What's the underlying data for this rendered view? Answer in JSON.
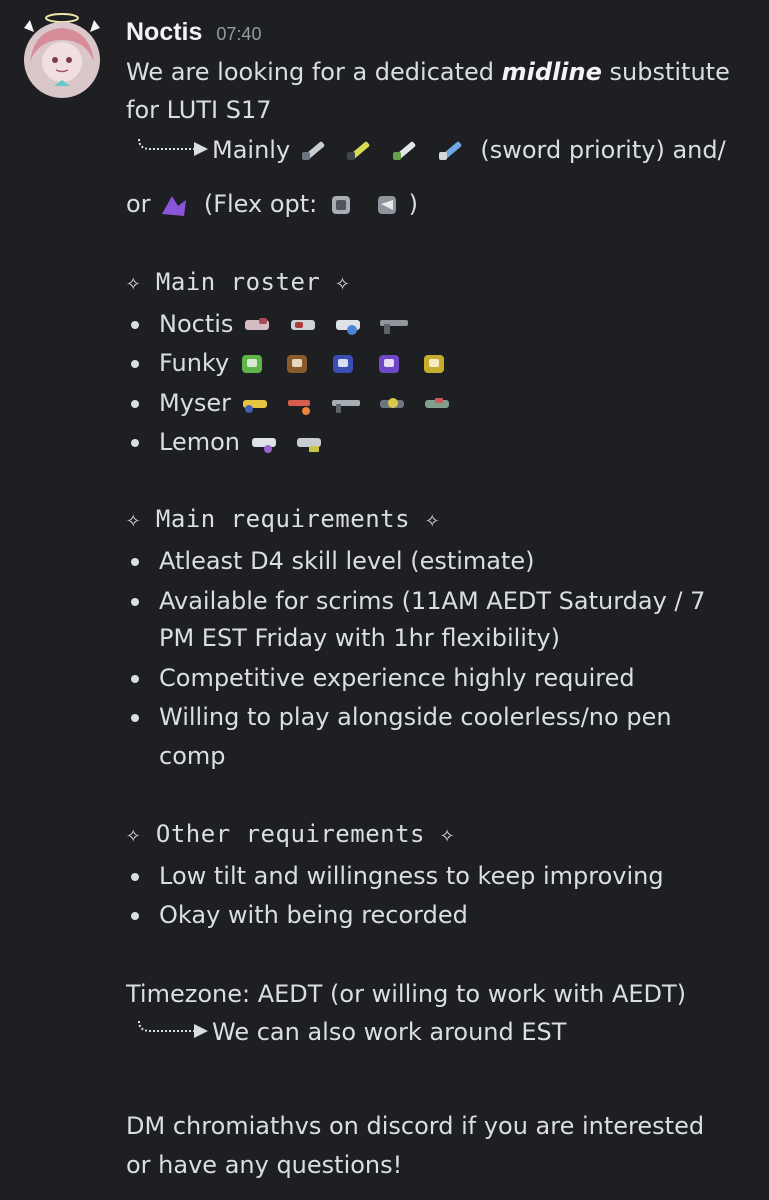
{
  "message": {
    "author": "Noctis",
    "timestamp": "07:40",
    "intro_1a": "We are looking for a dedicated ",
    "intro_1b": "midline",
    "intro_1c": " substitute",
    "intro_2": "for LUTI S17",
    "mainly_prefix": "Mainly",
    "mainly_suffix": "(sword priority) and/",
    "flex_prefix": "or",
    "flex_mid": "(Flex opt:",
    "flex_close": ")",
    "roster_heading": "✧ Main roster ✧",
    "roster": [
      {
        "name": "Noctis",
        "icons": [
          "weapon-icon",
          "weapon-icon",
          "weapon-icon",
          "weapon-icon"
        ]
      },
      {
        "name": "Funky",
        "icons": [
          "weapon-icon",
          "weapon-icon",
          "weapon-icon",
          "weapon-icon",
          "weapon-icon"
        ]
      },
      {
        "name": "Myser",
        "icons": [
          "weapon-icon",
          "weapon-icon",
          "weapon-icon",
          "weapon-icon",
          "weapon-icon"
        ]
      },
      {
        "name": "Lemon",
        "icons": [
          "weapon-icon",
          "weapon-icon"
        ]
      }
    ],
    "req_heading": "✧ Main requirements ✧",
    "requirements": [
      "Atleast D4 skill level (estimate)",
      "Available for scrims (11AM AEDT Saturday / 7",
      "PM EST Friday with 1hr flexibility)",
      "Competitive experience highly required",
      "Willing to play alongside coolerless/no pen",
      "comp"
    ],
    "other_heading": "✧ Other requirements ✧",
    "other_requirements": [
      "Low tilt and willingness to keep improving",
      "Okay with being recorded"
    ],
    "timezone": "Timezone: AEDT (or willing to work with AEDT)",
    "timezone_reply": "We can also work around EST",
    "dm_1": "DM chromiathvs on discord if you are interested",
    "dm_2": "or have any questions!"
  },
  "colors": {
    "background": "#1e1f22",
    "text": "#dbdee1",
    "author": "#f2f3f5",
    "timestamp": "#949ba4"
  }
}
